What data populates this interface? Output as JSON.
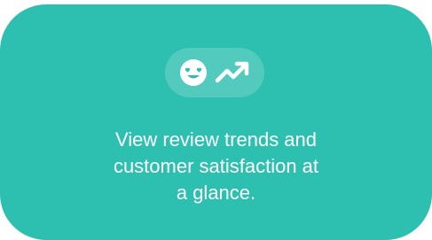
{
  "card": {
    "background": "#2dbfb0",
    "icons": [
      "smile-hearts-icon",
      "trending-up-icon"
    ],
    "lines": [
      "View review trends and",
      "customer satisfaction at",
      "a glance."
    ]
  }
}
